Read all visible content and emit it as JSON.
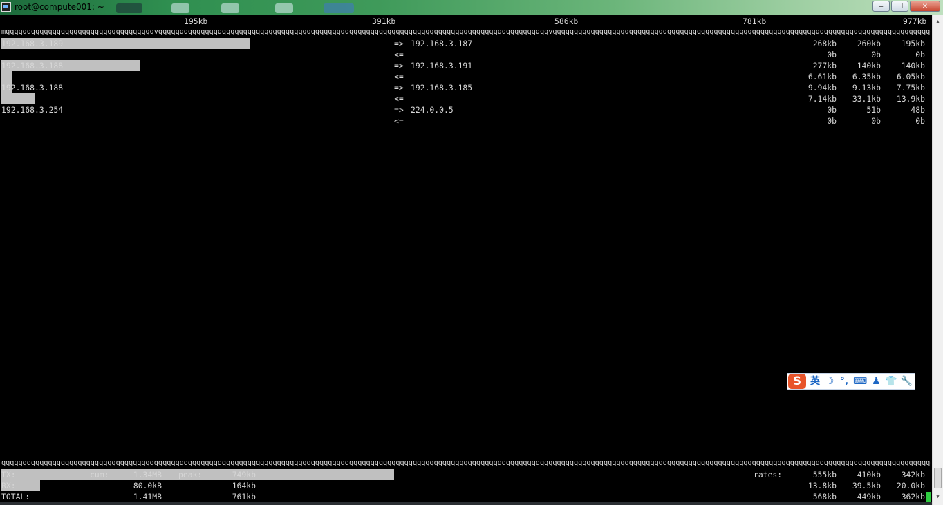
{
  "window": {
    "title": "root@compute001: ~",
    "buttons": {
      "minimize": "‒",
      "maximize": "❐",
      "close": "✕"
    }
  },
  "scale": {
    "marks": [
      "195kb",
      "391kb",
      "586kb",
      "781kb",
      "977kb"
    ],
    "rule_top": "mqqqqqqqqqqqqqqqqqqqqqqqqqqqqqqqqqqqvqqqqqqqqqqqqqqqqqqqqqqqqqqqqqqqqqqqqqqqqqqqqqqqqqqqqqqqqqqqqqqqqqqqqqqqqqqqqqqqqqqqqqqqqqqqqvqqqqqqqqqqqqqqqqqqqqqqqqqqqqqqqqqqqqqqqqqqqqqqqqqqqqqqqqqqqqqqqqqqqqqqqqqqqqqqqqqqqqqqqqqqqqqqqqqqqqqqqqqqqqqqqqqqqqqqqqqqqqqqqqq",
    "rule_bottom": "qqqqqqqqqqqqqqqqqqqqqqqqqqqqqqqqqqqqqqqqqqqqqqqqqqqqqqqqqqqqqqqqqqqqqqqqqqqqqqqqqqqqqqqqqqqqqqqqqqqqqqqqqqqqqqqqqqqqqqqqqqqqqqqqqqqqqqqqqqqqqqqqqqqqqqqqqqqqqqqqqqqqqqqqqqqqqqqqqqqqqqqqqqqqqqqqqqqqqqqqqqqqqqqqqqqqqqqqqqqqqqqqqqqqqqqqqqqqqqqqqqqqqqqqqqqqqqqqqqqqqqq"
  },
  "flows": [
    {
      "local": "192.168.3.189",
      "remote": "192.168.3.187",
      "out": {
        "dir": "=>",
        "r2": "268kb",
        "r10": "260kb",
        "r40": "195kb"
      },
      "in": {
        "dir": "<=",
        "r2": "0b",
        "r10": "0b",
        "r40": "0b"
      }
    },
    {
      "local": "192.168.3.188",
      "remote": "192.168.3.191",
      "out": {
        "dir": "=>",
        "r2": "277kb",
        "r10": "140kb",
        "r40": "140kb"
      },
      "in": {
        "dir": "<=",
        "r2": "6.61kb",
        "r10": "6.35kb",
        "r40": "6.05kb"
      }
    },
    {
      "local": "192.168.3.188",
      "remote": "192.168.3.185",
      "out": {
        "dir": "=>",
        "r2": "9.94kb",
        "r10": "9.13kb",
        "r40": "7.75kb"
      },
      "in": {
        "dir": "<=",
        "r2": "7.14kb",
        "r10": "33.1kb",
        "r40": "13.9kb"
      }
    },
    {
      "local": "192.168.3.254",
      "remote": "224.0.0.5",
      "out": {
        "dir": "=>",
        "r2": "0b",
        "r10": "51b",
        "r40": "48b"
      },
      "in": {
        "dir": "<=",
        "r2": "0b",
        "r10": "0b",
        "r40": "0b"
      }
    }
  ],
  "totals": {
    "tx": {
      "label": "TX:",
      "cum_label": "cum:",
      "cum": "1.34MB",
      "peak_label": "peak:",
      "peak": "749kb",
      "rates_label": "rates:",
      "r2": "555kb",
      "r10": "410kb",
      "r40": "342kb"
    },
    "rx": {
      "label": "RX:",
      "cum": "80.0kB",
      "peak": "164kb",
      "r2": "13.8kb",
      "r10": "39.5kb",
      "r40": "20.0kb"
    },
    "total": {
      "label": "TOTAL:",
      "cum": "1.41MB",
      "peak": "761kb",
      "r2": "568kb",
      "r10": "449kb",
      "r40": "362kb"
    }
  },
  "ime_toolbar": {
    "logo": "S",
    "items": [
      "英",
      "☽",
      "°,",
      "⌨",
      "♟",
      "👕",
      "🔧"
    ]
  },
  "colors": {
    "background": "#000000",
    "text": "#d6d6d6",
    "bar": "#c0c0c0",
    "cursor": "#2ecc40"
  }
}
